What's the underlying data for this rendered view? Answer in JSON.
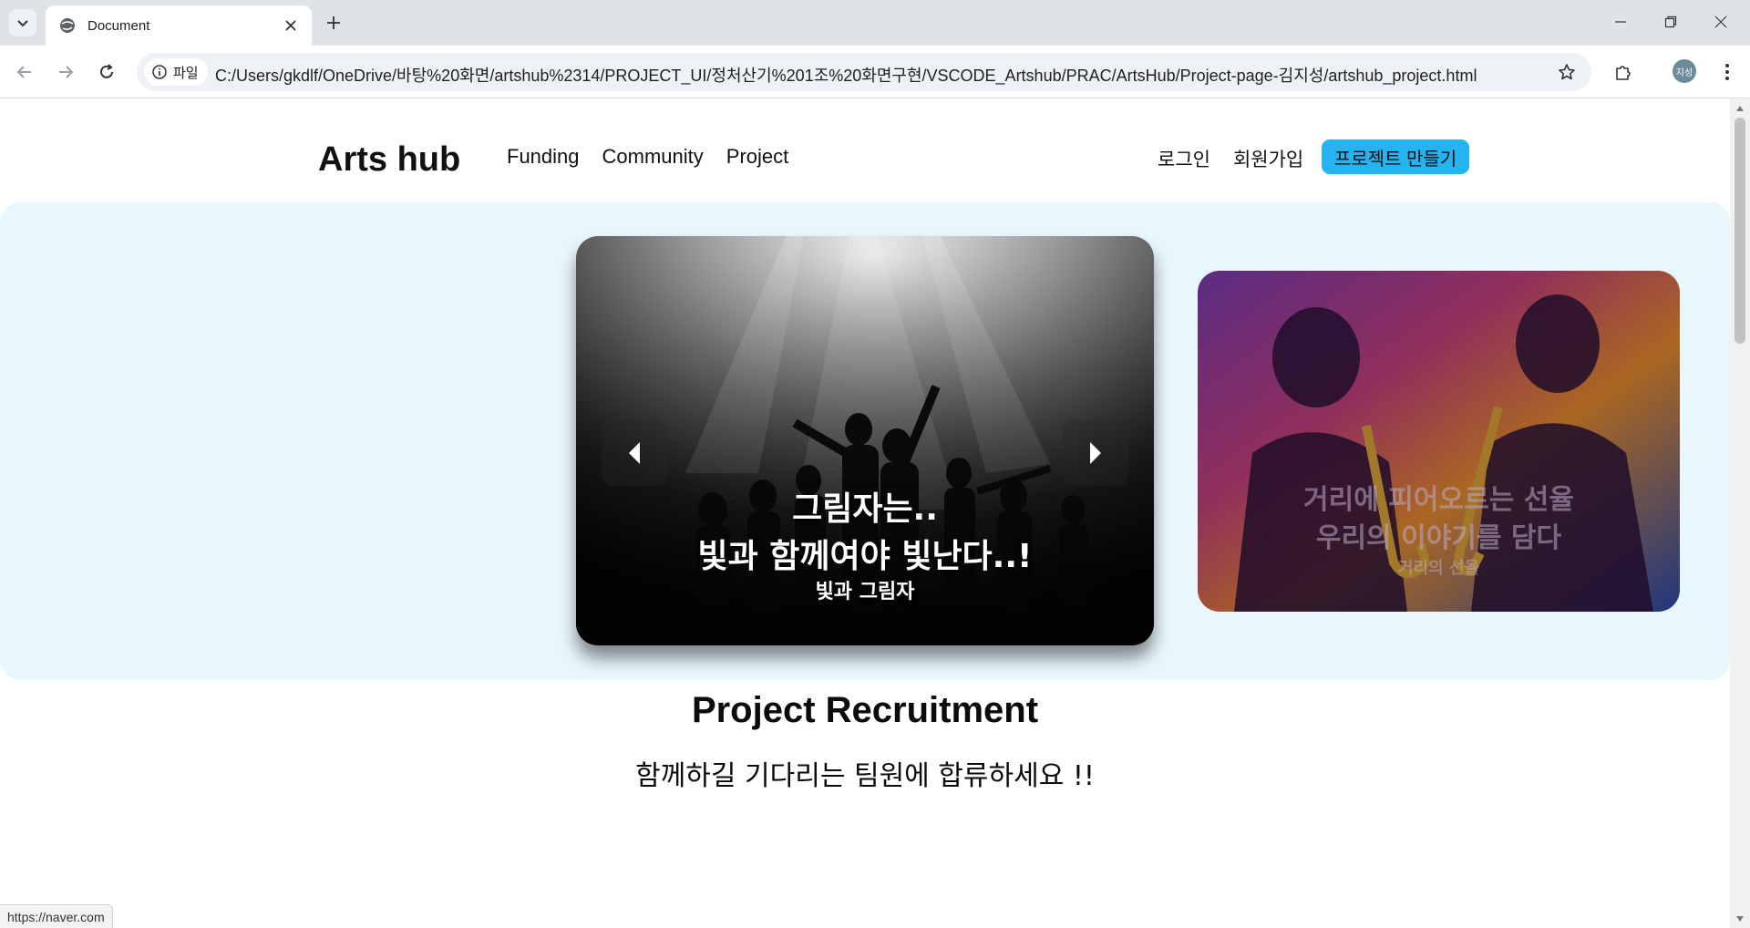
{
  "browser": {
    "tab_title": "Document",
    "site_chip_label": "파일",
    "url": "C:/Users/gkdlf/OneDrive/바탕%20화면/artshub%2314/PROJECT_UI/정처산기%201조%20화면구현/VSCODE_Artshub/PRAC/ArtsHub/Project-page-김지성/artshub_project.html",
    "profile_initials": "지성",
    "status_url": "https://naver.com"
  },
  "site": {
    "logo": "Arts hub",
    "nav": [
      "Funding",
      "Community",
      "Project"
    ],
    "login": "로그인",
    "signup": "회원가입",
    "create_project": "프로젝트 만들기"
  },
  "carousel": {
    "main": {
      "line1": "그림자는..",
      "line2": "빛과 함께여야 빛난다..!",
      "subtitle": "빛과 그림자"
    },
    "side": {
      "line1": "거리에 피어오르는 선율",
      "line2": "우리의 이야기를 담다",
      "subtitle": "거리의 선율"
    }
  },
  "section": {
    "title": "Project Recruitment",
    "subtitle": "함께하길 기다리는 팀원에 합류하세요 !!"
  },
  "colors": {
    "accent": "#25b4f0",
    "hero_bg": "#e8f7fd"
  }
}
